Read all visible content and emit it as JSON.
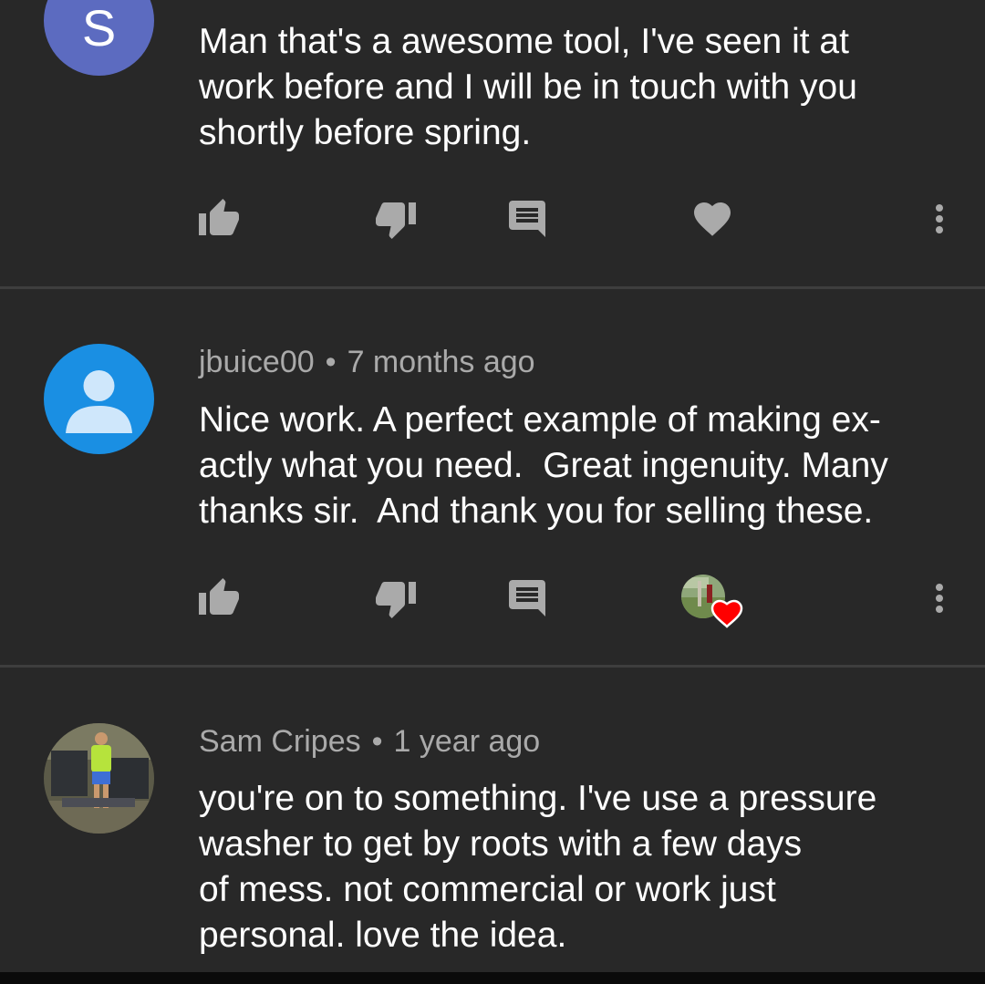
{
  "comments": [
    {
      "avatar_letter": "S",
      "author": "",
      "time": "",
      "body_lines": [
        "Man that's a awesome tool, I've seen it at",
        "work before and I will be in touch with you",
        "shortly before spring."
      ],
      "hearted": false
    },
    {
      "author": "jbuice00",
      "separator": "•",
      "time": "7 months ago",
      "body_lines": [
        "Nice work. A perfect example of making ex-",
        "actly what you need.  Great ingenuity. Many",
        "thanks sir.  And thank you for selling these."
      ],
      "hearted": true
    },
    {
      "author": "Sam Cripes",
      "separator": "•",
      "time": "1 year ago",
      "body_lines": [
        "you're on to something. I've use a pressure",
        "washer to get by roots with a few days",
        "of mess. not commercial or work just",
        "personal. love the idea."
      ]
    }
  ],
  "icons": {
    "like": "thumb-up-icon",
    "dislike": "thumb-down-icon",
    "reply": "comment-icon",
    "heart": "heart-icon",
    "menu": "more-vert-icon"
  },
  "colors": {
    "background": "#282828",
    "avatar_s": "#5c6bc0",
    "avatar_default": "#1a8fe3",
    "heart_red": "#ff0000",
    "icon_gray": "#aaaaaa"
  }
}
